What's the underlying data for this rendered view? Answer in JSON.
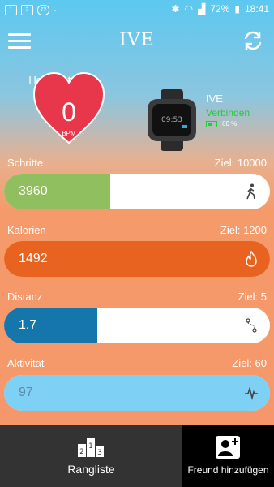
{
  "status_bar": {
    "left_icons": [
      "sim-icon",
      "sim-icon",
      "notification-icon",
      "dot-icon"
    ],
    "battery": "72%",
    "time": "18:41"
  },
  "header": {
    "title": "IVE"
  },
  "heart_rate": {
    "title": "Herz-Rate",
    "value": "0",
    "unit": "BPM"
  },
  "device": {
    "name": "IVE",
    "status": "Verbinden",
    "battery": "60 %"
  },
  "metrics": [
    {
      "label": "Schritte",
      "goal": "Ziel: 10000",
      "value": "3960",
      "progress": 0.4,
      "color": "#8fbf5e",
      "icon": "walking-icon"
    },
    {
      "label": "Kalorien",
      "goal": "Ziel: 1200",
      "value": "1492",
      "progress": 1.0,
      "color": "#e8631f",
      "icon": "flame-icon"
    },
    {
      "label": "Distanz",
      "goal": "Ziel: 5",
      "value": "1.7",
      "progress": 0.35,
      "color": "#1476aa",
      "icon": "route-icon"
    },
    {
      "label": "Aktivität",
      "goal": "Ziel: 60",
      "value": "97",
      "progress": 1.0,
      "color": "#7fd0f5",
      "icon": "pulse-icon"
    }
  ],
  "bottom_nav": {
    "leaderboard": "Rangliste",
    "add_friend": "Freund hinzufügen"
  }
}
